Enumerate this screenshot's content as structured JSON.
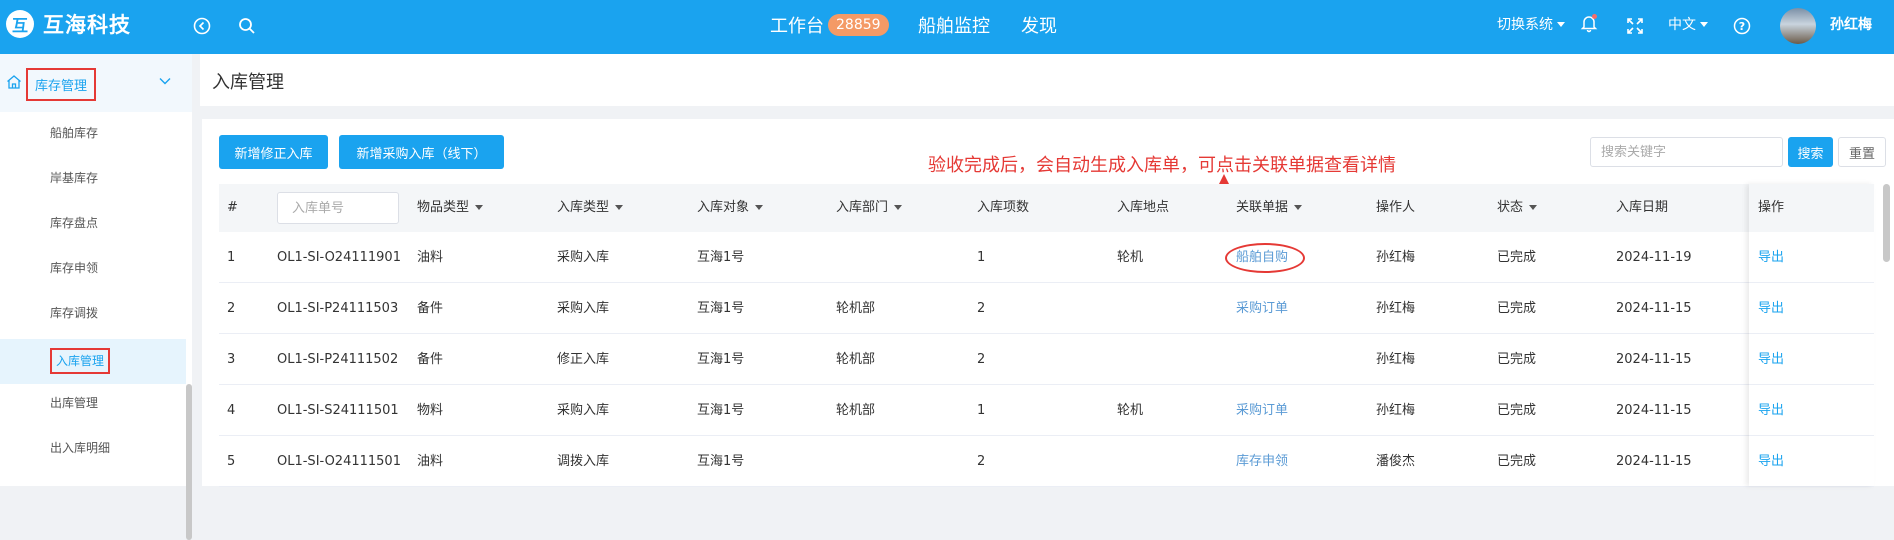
{
  "topbar": {
    "app_name": "互海科技",
    "logo_glyph": "互",
    "nav": [
      {
        "label": "工作台",
        "badge": "28859"
      },
      {
        "label": "船舶监控"
      },
      {
        "label": "发现"
      }
    ],
    "switch_system": "切换系统",
    "language": "中文",
    "user_name": "孙红梅",
    "icons": [
      "back-icon",
      "search-icon",
      "bell-icon",
      "fullscreen-icon",
      "help-icon"
    ],
    "colors": {
      "bar": "#1aa3ef",
      "badge": "#f49a66",
      "notification_dot": "#f56c6c"
    }
  },
  "sidebar": {
    "group_label": "库存管理",
    "items": [
      {
        "label": "船舶库存"
      },
      {
        "label": "岸基库存"
      },
      {
        "label": "库存盘点"
      },
      {
        "label": "库存申领"
      },
      {
        "label": "库存调拨"
      },
      {
        "label": "入库管理",
        "active": true
      },
      {
        "label": "出库管理"
      },
      {
        "label": "出入库明细"
      }
    ]
  },
  "page": {
    "title": "入库管理",
    "buttons": {
      "add_correction": "新增修正入库",
      "add_purchase": "新增采购入库（线下）"
    },
    "annotation": "验收完成后，会自动生成入库单，可点击关联单据查看详情",
    "search": {
      "placeholder": "搜索关键字",
      "value": "",
      "search_label": "搜索",
      "reset_label": "重置"
    }
  },
  "table": {
    "order_no_placeholder": "入库单号",
    "headers": {
      "idx": "#",
      "item_type": "物品类型",
      "in_type": "入库类型",
      "target": "入库对象",
      "dept": "入库部门",
      "count": "入库项数",
      "location": "入库地点",
      "related": "关联单据",
      "operator": "操作人",
      "status": "状态",
      "date": "入库日期",
      "action": "操作"
    },
    "rows": [
      {
        "idx": "1",
        "no": "OL1-SI-O24111901",
        "item_type": "油料",
        "in_type": "采购入库",
        "target": "互海1号",
        "dept": "",
        "count": "1",
        "location": "轮机",
        "related": "船舶自购",
        "operator": "孙红梅",
        "status": "已完成",
        "date": "2024-11-19",
        "action": "导出"
      },
      {
        "idx": "2",
        "no": "OL1-SI-P24111503",
        "item_type": "备件",
        "in_type": "采购入库",
        "target": "互海1号",
        "dept": "轮机部",
        "count": "2",
        "location": "",
        "related": "采购订单",
        "operator": "孙红梅",
        "status": "已完成",
        "date": "2024-11-15",
        "action": "导出"
      },
      {
        "idx": "3",
        "no": "OL1-SI-P24111502",
        "item_type": "备件",
        "in_type": "修正入库",
        "target": "互海1号",
        "dept": "轮机部",
        "count": "2",
        "location": "",
        "related": "",
        "operator": "孙红梅",
        "status": "已完成",
        "date": "2024-11-15",
        "action": "导出"
      },
      {
        "idx": "4",
        "no": "OL1-SI-S24111501",
        "item_type": "物料",
        "in_type": "采购入库",
        "target": "互海1号",
        "dept": "轮机部",
        "count": "1",
        "location": "轮机",
        "related": "采购订单",
        "operator": "孙红梅",
        "status": "已完成",
        "date": "2024-11-15",
        "action": "导出"
      },
      {
        "idx": "5",
        "no": "OL1-SI-O24111501",
        "item_type": "油料",
        "in_type": "调拨入库",
        "target": "互海1号",
        "dept": "",
        "count": "2",
        "location": "",
        "related": "库存申领",
        "operator": "潘俊杰",
        "status": "已完成",
        "date": "2024-11-15",
        "action": "导出"
      }
    ]
  }
}
